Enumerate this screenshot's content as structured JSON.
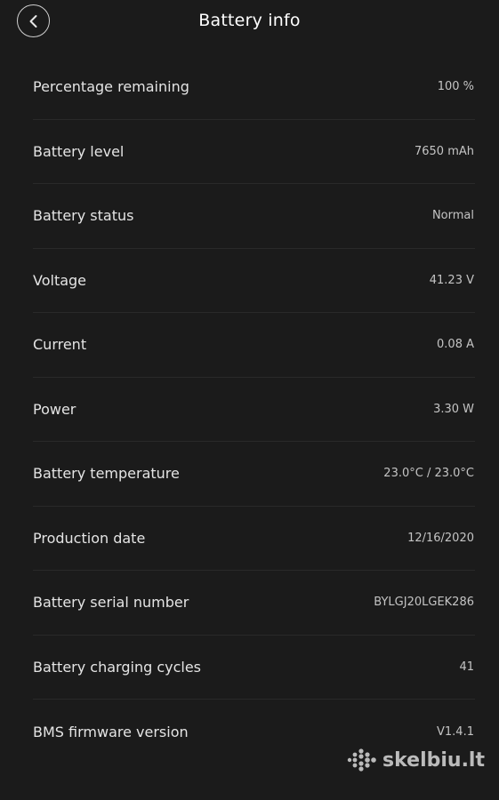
{
  "header": {
    "title": "Battery info"
  },
  "rows": [
    {
      "label": "Percentage remaining",
      "value": "100 %"
    },
    {
      "label": "Battery level",
      "value": "7650 mAh"
    },
    {
      "label": "Battery status",
      "value": "Normal"
    },
    {
      "label": "Voltage",
      "value": "41.23 V"
    },
    {
      "label": "Current",
      "value": "0.08 A"
    },
    {
      "label": "Power",
      "value": "3.30 W"
    },
    {
      "label": "Battery temperature",
      "value": "23.0°C / 23.0°C"
    },
    {
      "label": "Production date",
      "value": "12/16/2020"
    },
    {
      "label": "Battery serial number",
      "value": "BYLGJ20LGEK286"
    },
    {
      "label": "Battery charging cycles",
      "value": "41"
    },
    {
      "label": "BMS firmware version",
      "value": "V1.4.1"
    }
  ],
  "watermark": {
    "text": "skelbiu.lt",
    "icon": "dots-logo-icon"
  }
}
